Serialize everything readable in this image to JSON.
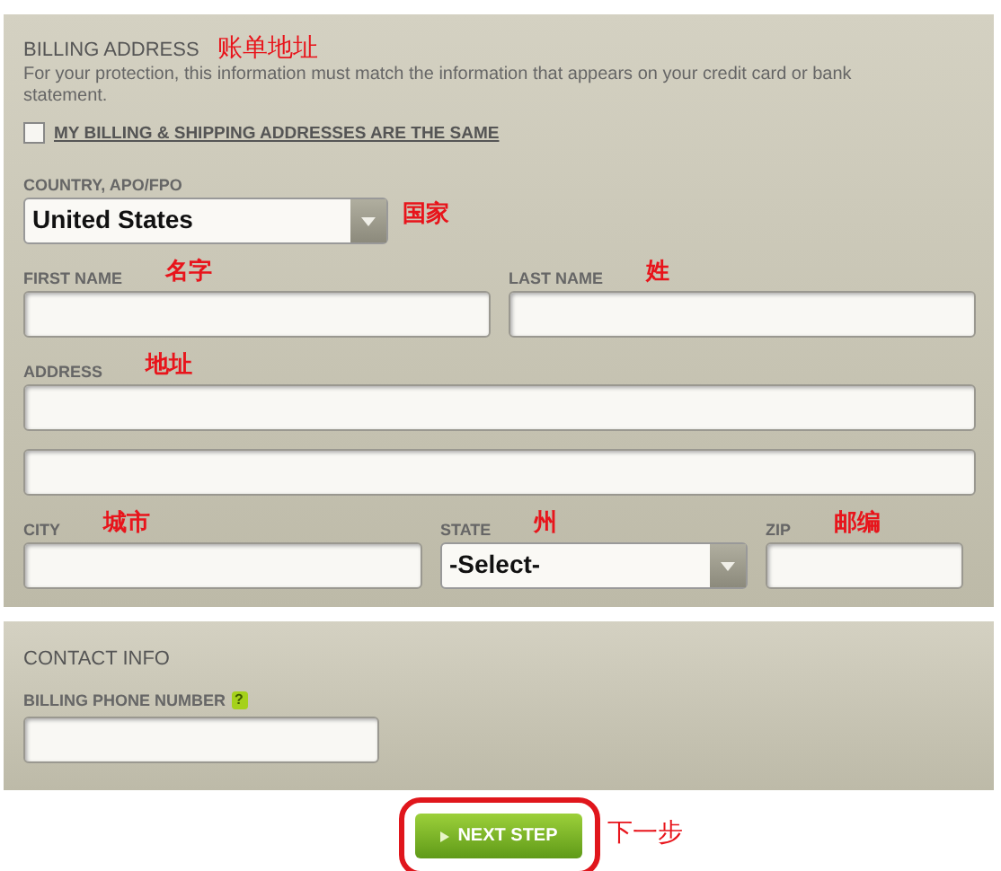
{
  "billing": {
    "title": "BILLING ADDRESS",
    "title_note": "账单地址",
    "description": "For your protection, this information must match the information that appears on your credit card or bank statement.",
    "same_address": {
      "label": "MY BILLING & SHIPPING ADDRESSES ARE THE SAME",
      "checked": false
    },
    "rows": [
      [
        {
          "kind": "select",
          "label": "COUNTRY, APO/FPO",
          "note": "国家",
          "value": "United States"
        }
      ],
      [
        {
          "kind": "text",
          "label": "FIRST NAME",
          "note": "名字"
        },
        {
          "kind": "text",
          "label": "LAST NAME",
          "note": "姓"
        }
      ],
      [
        {
          "kind": "text",
          "label": "ADDRESS",
          "note": "地址"
        }
      ],
      [
        {
          "kind": "text"
        }
      ],
      [
        {
          "kind": "text",
          "label": "CITY",
          "note": "城市"
        },
        {
          "kind": "select",
          "label": "STATE",
          "note": "州",
          "value": "-Select-"
        },
        {
          "kind": "text",
          "label": "ZIP",
          "note": "邮编"
        }
      ]
    ]
  },
  "contact": {
    "title": "CONTACT INFO",
    "phone_label": "BILLING PHONE NUMBER",
    "help": "?"
  },
  "next_button": {
    "label": "NEXT STEP",
    "note": "下一步"
  }
}
